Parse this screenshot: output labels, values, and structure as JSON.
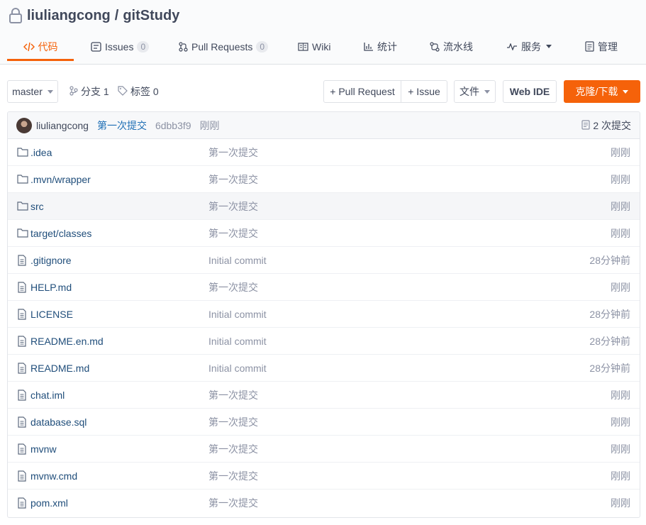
{
  "repo": {
    "owner": "liuliangcong",
    "slash": "/",
    "name": "gitStudy"
  },
  "tabs": [
    {
      "label": "代码",
      "icon": "code-icon",
      "active": true
    },
    {
      "label": "Issues",
      "icon": "issues-icon",
      "badge": "0"
    },
    {
      "label": "Pull Requests",
      "icon": "pull-request-icon",
      "badge": "0"
    },
    {
      "label": "Wiki",
      "icon": "wiki-icon"
    },
    {
      "label": "统计",
      "icon": "stats-icon"
    },
    {
      "label": "流水线",
      "icon": "pipeline-icon"
    },
    {
      "label": "服务",
      "icon": "service-icon",
      "dropdown": true
    },
    {
      "label": "管理",
      "icon": "manage-icon"
    }
  ],
  "toolbar": {
    "branch": "master",
    "branches_label": "分支 1",
    "tags_label": "标签 0",
    "pull_request": "+ Pull Request",
    "issue": "+ Issue",
    "file": "文件",
    "web_ide": "Web IDE",
    "clone": "克隆/下载"
  },
  "commit": {
    "author": "liuliangcong",
    "message": "第一次提交",
    "hash": "6dbb3f9",
    "time": "刚刚",
    "count_label": "2 次提交"
  },
  "files": [
    {
      "name": ".idea",
      "type": "folder",
      "message": "第一次提交",
      "time": "刚刚"
    },
    {
      "name": ".mvn/wrapper",
      "type": "folder",
      "message": "第一次提交",
      "time": "刚刚"
    },
    {
      "name": "src",
      "type": "folder",
      "message": "第一次提交",
      "time": "刚刚"
    },
    {
      "name": "target/classes",
      "type": "folder",
      "message": "第一次提交",
      "time": "刚刚"
    },
    {
      "name": ".gitignore",
      "type": "file",
      "message": "Initial commit",
      "time": "28分钟前"
    },
    {
      "name": "HELP.md",
      "type": "file",
      "message": "第一次提交",
      "time": "刚刚"
    },
    {
      "name": "LICENSE",
      "type": "file",
      "message": "Initial commit",
      "time": "28分钟前"
    },
    {
      "name": "README.en.md",
      "type": "file",
      "message": "Initial commit",
      "time": "28分钟前"
    },
    {
      "name": "README.md",
      "type": "file",
      "message": "Initial commit",
      "time": "28分钟前"
    },
    {
      "name": "chat.iml",
      "type": "file",
      "message": "第一次提交",
      "time": "刚刚"
    },
    {
      "name": "database.sql",
      "type": "file",
      "message": "第一次提交",
      "time": "刚刚"
    },
    {
      "name": "mvnw",
      "type": "file",
      "message": "第一次提交",
      "time": "刚刚"
    },
    {
      "name": "mvnw.cmd",
      "type": "file",
      "message": "第一次提交",
      "time": "刚刚"
    },
    {
      "name": "pom.xml",
      "type": "file",
      "message": "第一次提交",
      "time": "刚刚"
    }
  ],
  "colors": {
    "accent": "#f5620a",
    "link": "#1f4d7a",
    "muted": "#8c92a4"
  }
}
